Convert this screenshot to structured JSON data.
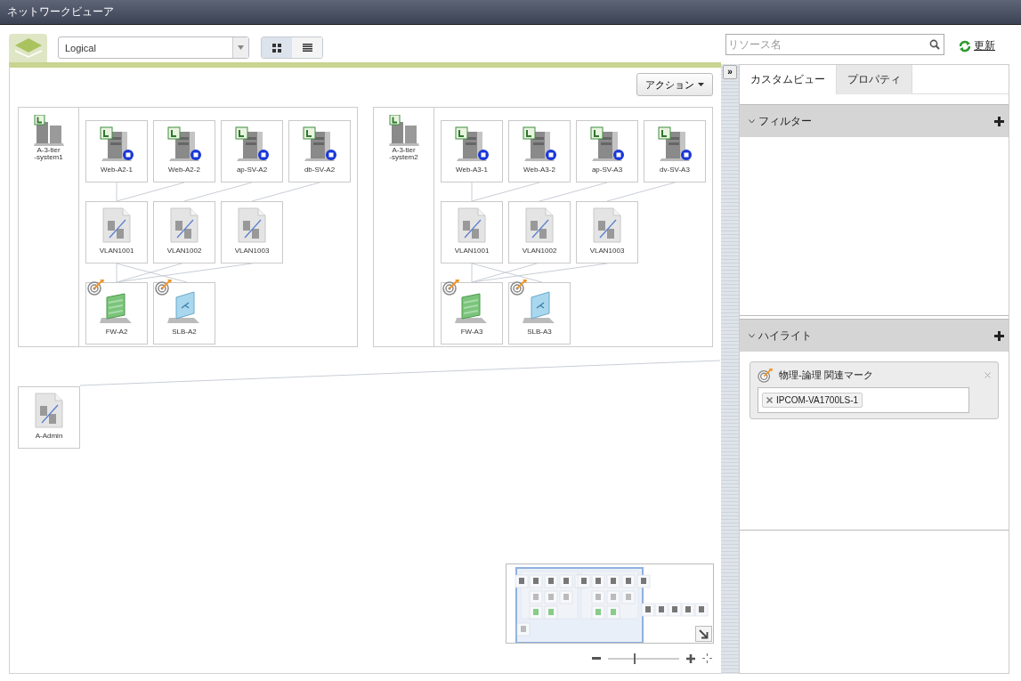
{
  "window": {
    "title": "ネットワークビューア"
  },
  "toolbar": {
    "view_select": {
      "value": "Logical"
    },
    "view_modes": [
      {
        "kind": "grid",
        "selected": true
      },
      {
        "kind": "list",
        "selected": false
      }
    ],
    "search": {
      "placeholder": "リソース名"
    },
    "refresh": "更新"
  },
  "canvas": {
    "action_button": "アクション",
    "groups": [
      {
        "name": "A-3-tier\n-system1",
        "rows": [
          [
            {
              "label": "Web-A2-1",
              "kind": "server",
              "marked": false
            },
            {
              "label": "Web-A2-2",
              "kind": "server",
              "marked": false
            },
            {
              "label": "ap-SV-A2",
              "kind": "server",
              "marked": false
            },
            {
              "label": "db-SV-A2",
              "kind": "server",
              "marked": false
            }
          ],
          [
            {
              "label": "VLAN1001",
              "kind": "vlan",
              "marked": false
            },
            {
              "label": "VLAN1002",
              "kind": "vlan",
              "marked": false
            },
            {
              "label": "VLAN1003",
              "kind": "vlan",
              "marked": false
            }
          ],
          [
            {
              "label": "FW-A2",
              "kind": "firewall",
              "marked": true
            },
            {
              "label": "SLB-A2",
              "kind": "loadbalancer",
              "marked": true
            }
          ]
        ]
      },
      {
        "name": "A-3-tier\n-system2",
        "rows": [
          [
            {
              "label": "Web-A3-1",
              "kind": "server",
              "marked": false
            },
            {
              "label": "Web-A3-2",
              "kind": "server",
              "marked": false
            },
            {
              "label": "ap-SV-A3",
              "kind": "server",
              "marked": false
            },
            {
              "label": "dv-SV-A3",
              "kind": "server",
              "marked": false
            }
          ],
          [
            {
              "label": "VLAN1001",
              "kind": "vlan",
              "marked": false
            },
            {
              "label": "VLAN1002",
              "kind": "vlan",
              "marked": false
            },
            {
              "label": "VLAN1003",
              "kind": "vlan",
              "marked": false
            }
          ],
          [
            {
              "label": "FW-A3",
              "kind": "firewall",
              "marked": true
            },
            {
              "label": "SLB-A3",
              "kind": "loadbalancer",
              "marked": true
            }
          ]
        ]
      }
    ],
    "standalone_nodes": [
      {
        "label": "A-Admin",
        "kind": "vlan",
        "marked": false
      }
    ],
    "zoom": {
      "level": 0.36
    }
  },
  "collapse_toggle": "»",
  "side_panel": {
    "tabs": [
      {
        "label": "カスタムビュー",
        "selected": true
      },
      {
        "label": "プロパティ",
        "selected": false
      }
    ],
    "sections": [
      {
        "title": "フィルター",
        "expanded": true
      },
      {
        "title": "ハイライト",
        "expanded": true,
        "items": [
          {
            "title": "物理-論理 関連マーク",
            "tags": [
              "IPCOM-VA1700LS-1"
            ]
          }
        ]
      }
    ]
  }
}
